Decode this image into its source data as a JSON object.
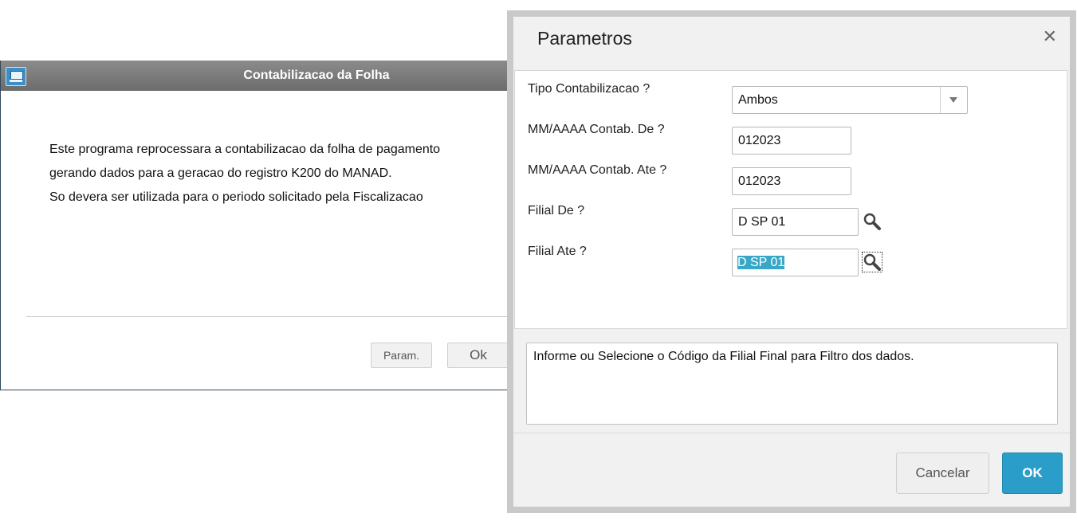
{
  "back_window": {
    "title": "Contabilizacao da Folha",
    "description_lines": [
      "Este programa reprocessara a contabilizacao da folha de pagamento",
      "gerando dados para a geracao do registro K200 do MANAD.",
      "So devera ser utilizada para o periodo solicitado pela Fiscalizacao"
    ],
    "param_label": "Param.",
    "ok_label": "Ok"
  },
  "dialog": {
    "title": "Parametros",
    "close_glyph": "✕",
    "fields": [
      {
        "label": "Tipo Contabilizacao ?",
        "value": "Ambos",
        "type": "select"
      },
      {
        "label": "MM/AAAA Contab. De ?",
        "value": "012023",
        "type": "text"
      },
      {
        "label": "MM/AAAA Contab. Ate ?",
        "value": "012023",
        "type": "text"
      },
      {
        "label": "Filial De ?",
        "value": "D SP 01",
        "type": "lookup"
      },
      {
        "label": "Filial Ate ?",
        "value": "D SP 01",
        "type": "lookup",
        "focused": true
      }
    ],
    "help_text": "Informe ou Selecione o Código da Filial Final para Filtro dos dados.",
    "cancel_label": "Cancelar",
    "ok_label": "OK"
  },
  "icons": {
    "app": "monitor-icon",
    "close": "close-icon",
    "lookup": "magnifier-icon",
    "dropdown": "chevron-down-icon"
  },
  "colors": {
    "titlebar": "#7a7a7a",
    "primary_button": "#2a9ec9",
    "selection": "#3aa7c7"
  }
}
